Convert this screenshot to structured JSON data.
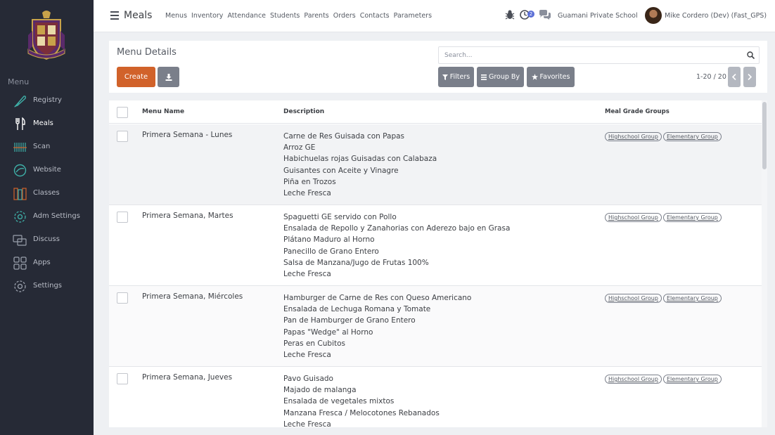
{
  "sidebar": {
    "menu_heading": "Menu",
    "items": [
      {
        "label": "Registry",
        "icon": "feather-pen-icon"
      },
      {
        "label": "Meals",
        "icon": "fork-knife-icon"
      },
      {
        "label": "Scan",
        "icon": "barcode-icon"
      },
      {
        "label": "Website",
        "icon": "globe-icon"
      },
      {
        "label": "Classes",
        "icon": "books-icon"
      },
      {
        "label": "Adm Settings",
        "icon": "gear-icon"
      },
      {
        "label": "Discuss",
        "icon": "chat-bubbles-icon"
      },
      {
        "label": "Apps",
        "icon": "grid-icon"
      },
      {
        "label": "Settings",
        "icon": "gear-icon"
      }
    ],
    "active_item": "Meals"
  },
  "topbar": {
    "app_title": "Meals",
    "nav": [
      "Menus",
      "Inventory",
      "Attendance",
      "Students",
      "Parents",
      "Orders",
      "Contacts",
      "Parameters"
    ],
    "activity_count": "2",
    "company": "Guamani Private School",
    "user": "Mike Cordero (Dev) (Fast_GPS)"
  },
  "control": {
    "page_title": "Menu Details",
    "create_label": "Create",
    "search_placeholder": "Search...",
    "filters_label": "Filters",
    "groupby_label": "Group By",
    "favorites_label": "Favorites",
    "pager_text": "1-20 / 20"
  },
  "table": {
    "headers": {
      "name": "Menu Name",
      "description": "Description",
      "groups": "Meal Grade Groups"
    },
    "rows": [
      {
        "name": "Primera Semana - Lunes",
        "description": [
          "Carne de Res Guisada con Papas",
          "Arroz GE",
          "Habichuelas rojas Guisadas con Calabaza",
          "Guisantes con Aceite y Vinagre",
          "Piña en Trozos",
          "Leche Fresca"
        ],
        "groups": [
          "Highschool Group",
          "Elementary Group"
        ]
      },
      {
        "name": "Primera Semana, Martes",
        "description": [
          "Spaguetti GE servido con  Pollo",
          "Ensalada de Repollo y Zanahorias con Aderezo bajo en Grasa",
          "Plátano Maduro al Horno",
          "Panecillo de Grano Entero",
          "Salsa de Manzana/Jugo de Frutas 100%",
          "Leche Fresca"
        ],
        "groups": [
          "Highschool Group",
          "Elementary Group"
        ]
      },
      {
        "name": "Primera Semana, Miércoles",
        "description": [
          "Hamburger de Carne de Res con Queso Americano",
          "Ensalada de Lechuga Romana y Tomate",
          "Pan de Hamburger de Grano Entero",
          "Papas \"Wedge\" al Horno",
          "Peras en Cubitos",
          "Leche Fresca"
        ],
        "groups": [
          "Highschool Group",
          "Elementary Group"
        ]
      },
      {
        "name": "Primera Semana, Jueves",
        "description": [
          "Pavo Guisado",
          "Majado de malanga",
          "Ensalada de vegetales mixtos",
          "Manzana Fresca / Melocotones Rebanados",
          "Leche Fresca"
        ],
        "groups": [
          "Highschool Group",
          "Elementary Group"
        ]
      }
    ]
  },
  "colors": {
    "sidebar_bg": "#262a36",
    "primary": "#d1622a",
    "secondary_btn": "#7a7f8a",
    "activity_badge": "#5b6fd6"
  }
}
